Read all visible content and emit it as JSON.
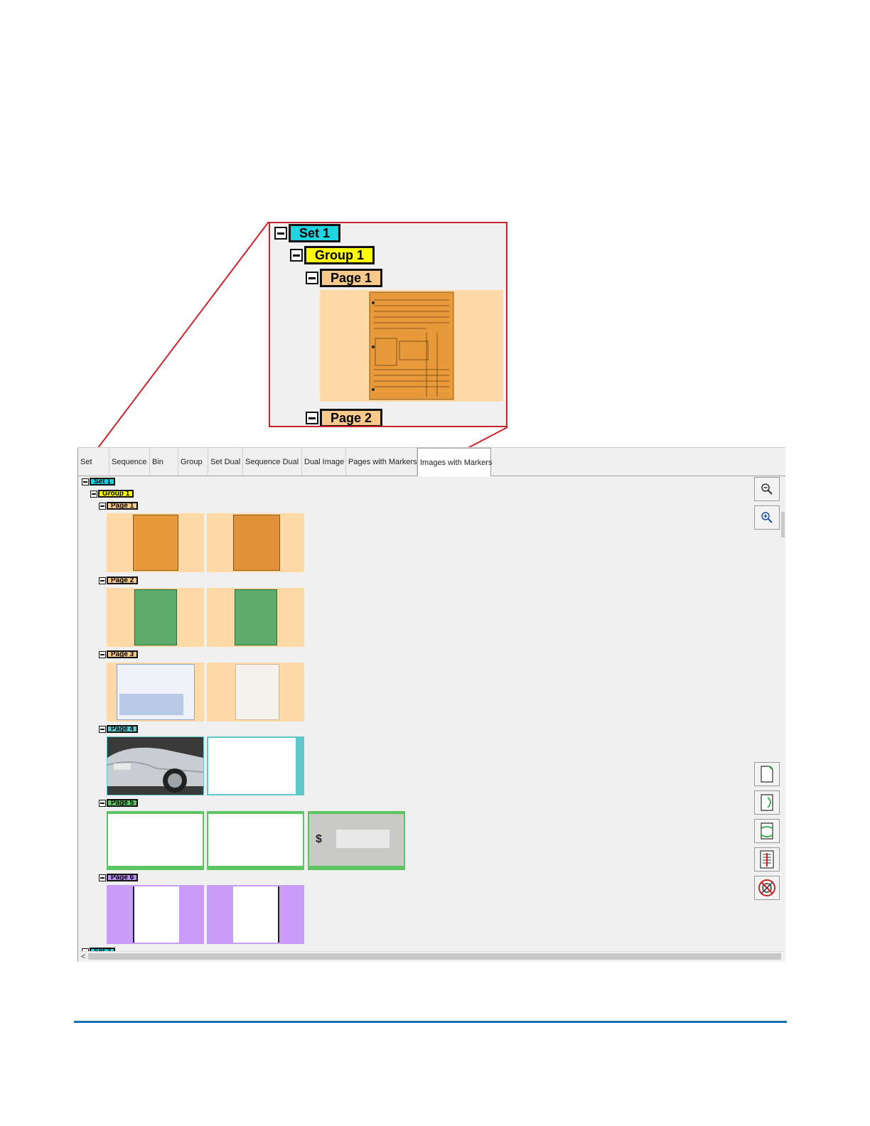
{
  "callout": {
    "set_label": "Set 1",
    "group_label": "Group 1",
    "page1_label": "Page 1",
    "page2_label": "Page 2"
  },
  "tabs": [
    {
      "label": "Set"
    },
    {
      "label": "Sequence"
    },
    {
      "label": "Bin"
    },
    {
      "label": "Group"
    },
    {
      "label": "Set Dual"
    },
    {
      "label": "Sequence Dual"
    },
    {
      "label": "Dual Image"
    },
    {
      "label": "Pages with Markers"
    },
    {
      "label": "Images with Markers",
      "active": true
    }
  ],
  "tree": {
    "set1": "Set 1",
    "group1": "Group 1",
    "pages": [
      {
        "label": "Page 1",
        "color": "#f7c98b"
      },
      {
        "label": "Page 2",
        "color": "#f7c98b"
      },
      {
        "label": "Page 3",
        "color": "#f7c98b"
      },
      {
        "label": "Page 4",
        "color": "#5fc6c9"
      },
      {
        "label": "Page 5",
        "color": "#5cc461"
      },
      {
        "label": "Page 6",
        "color": "#b98ef0"
      }
    ],
    "set2": "Set 2"
  },
  "colors": {
    "set": "#1fd3e0",
    "group": "#ffff00",
    "marker_orange": "#ffd9a6",
    "marker_teal": "#5fc6c9",
    "marker_green": "#5cc461",
    "marker_purple": "#c99df7",
    "callout_border": "#c8242b",
    "footer_rule": "#1a6fb0"
  },
  "toolbar": {
    "zoom_out_icon": "zoom-out-icon",
    "zoom_in_icon": "zoom-in-icon",
    "rotate_right_icon": "rotate-right-icon",
    "rotate_left_icon": "rotate-left-icon",
    "rotate_180_icon": "rotate-180-icon",
    "split_icon": "split-document-icon",
    "delete_icon": "delete-icon"
  }
}
